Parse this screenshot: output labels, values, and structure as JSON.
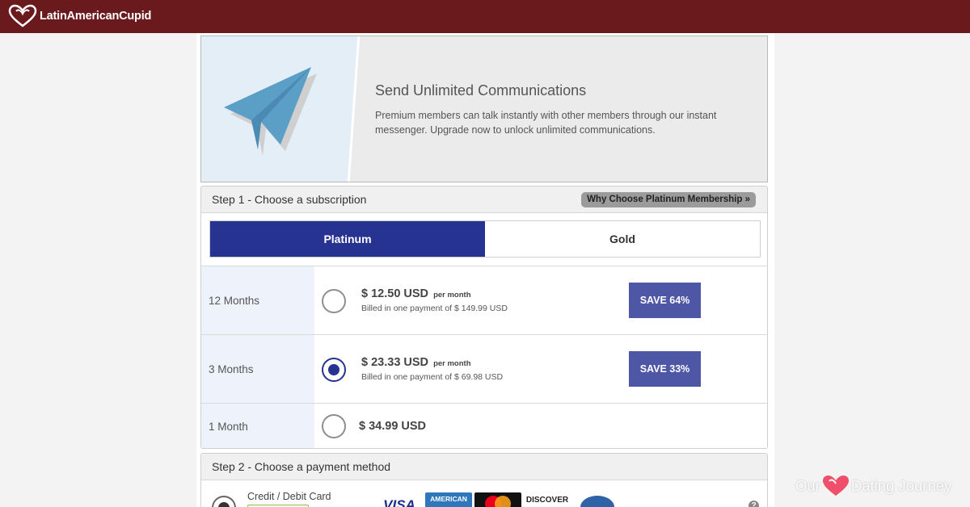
{
  "header": {
    "brand": "LatinAmericanCupid",
    "logo_icon": "heart-outline-icon"
  },
  "hero": {
    "icon": "paper-plane-icon",
    "title": "Send Unlimited Communications",
    "description": "Premium members can talk instantly with other members through our instant messenger. Upgrade now to unlock unlimited communications."
  },
  "step1": {
    "title": "Step 1 - Choose a subscription",
    "why_label": "Why Choose Platinum Membership »",
    "tabs": [
      {
        "label": "Platinum",
        "active": true
      },
      {
        "label": "Gold",
        "active": false
      }
    ],
    "plans": [
      {
        "duration": "12 Months",
        "price": "$ 12.50 USD",
        "per": "per month",
        "billed": "Billed in one payment of $ 149.99 USD",
        "save": "SAVE 64%",
        "selected": false
      },
      {
        "duration": "3 Months",
        "price": "$ 23.33 USD",
        "per": "per month",
        "billed": "Billed in one payment of $ 69.98 USD",
        "save": "SAVE 33%",
        "selected": true
      },
      {
        "duration": "1 Month",
        "price": "$ 34.99 USD",
        "selected": false
      }
    ]
  },
  "step2": {
    "title": "Step 2 - Choose a payment method",
    "method_label": "Credit / Debit Card",
    "cards": {
      "visa": "VISA",
      "amex": "AMERICAN",
      "discover": "DISCOVER"
    },
    "help_icon": "question-circle-icon",
    "help_glyph": "?"
  },
  "watermark": {
    "left": "Our",
    "right": "Dating Journey",
    "icon": "heart-icon"
  },
  "colors": {
    "topbar": "#6a1a1c",
    "accent": "#273391",
    "save_badge": "#4e57a5"
  }
}
